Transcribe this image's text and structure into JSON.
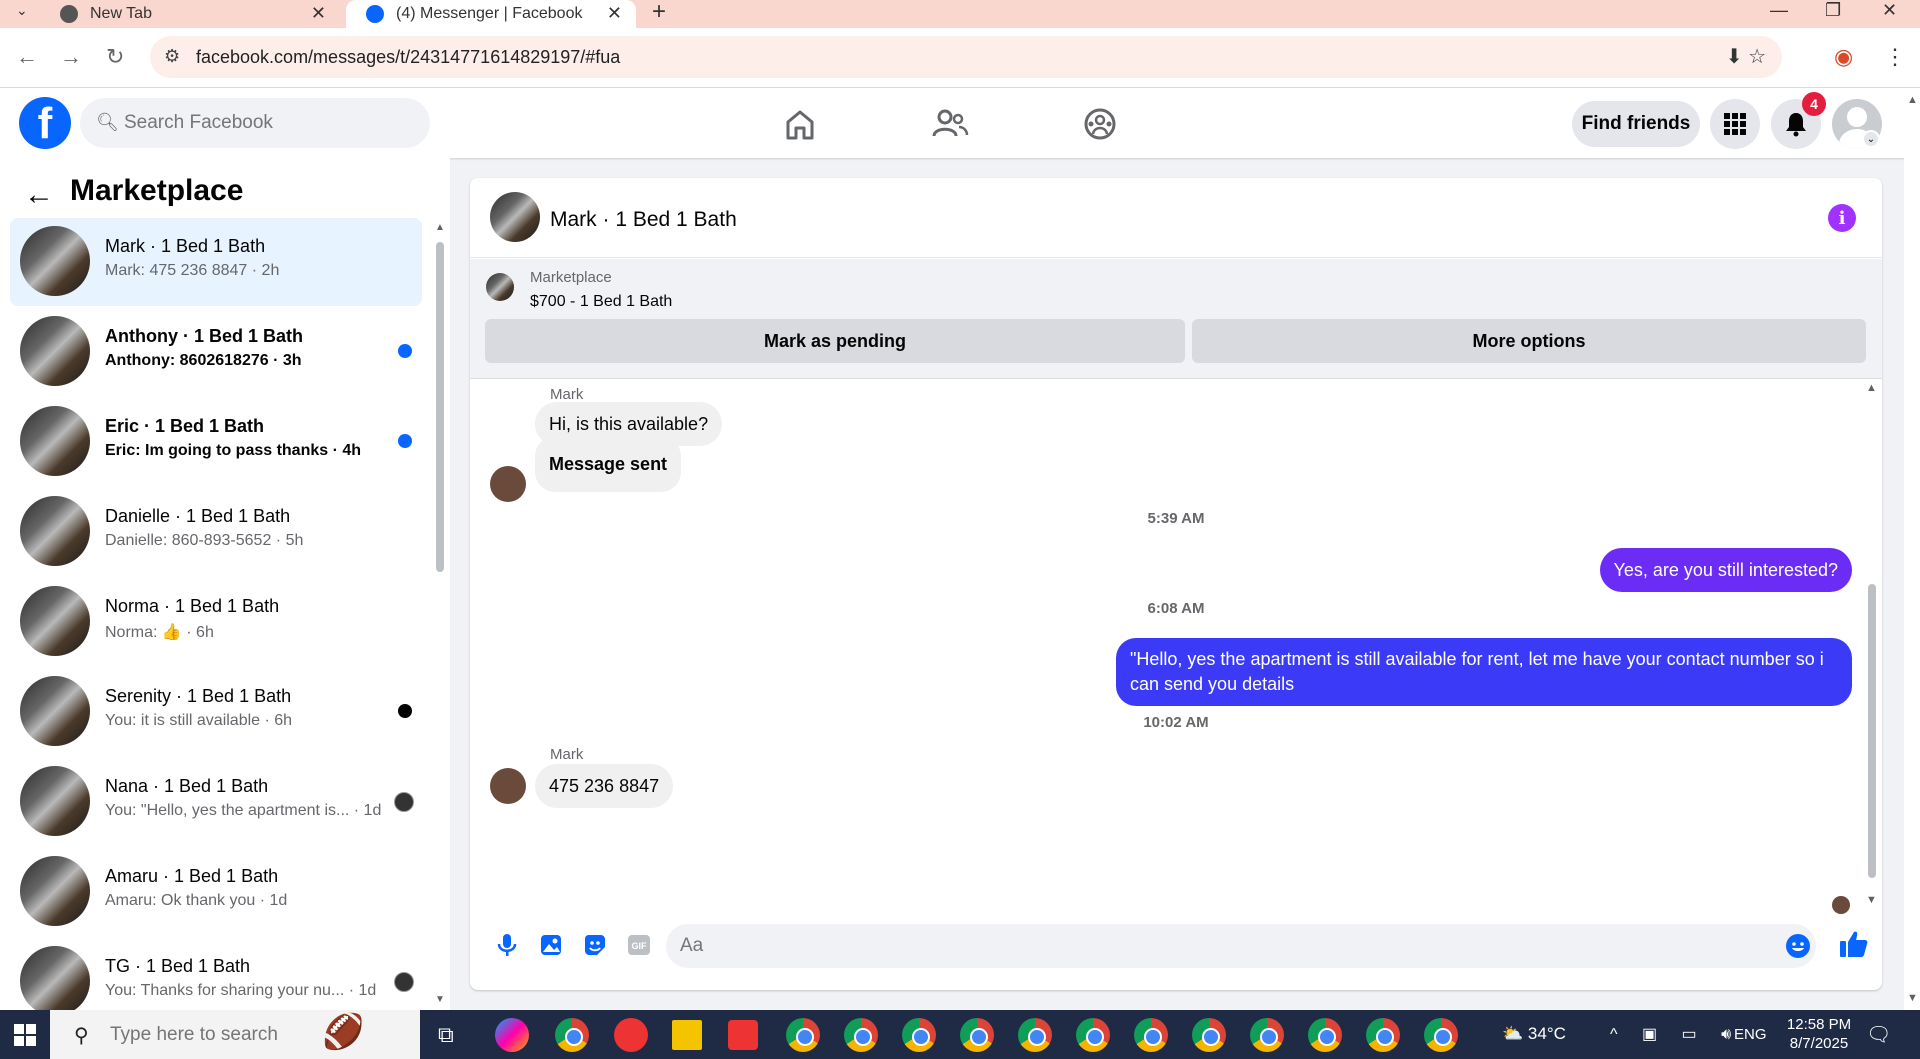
{
  "browser": {
    "tabs": [
      {
        "title": "New Tab",
        "active": false
      },
      {
        "title": "(4) Messenger | Facebook",
        "active": true
      }
    ],
    "url": "facebook.com/messages/t/24314771614829197/#fua"
  },
  "header": {
    "search_placeholder": "Search Facebook",
    "find_friends": "Find friends",
    "notification_count": "4"
  },
  "sidebar": {
    "title": "Marketplace",
    "conversations": [
      {
        "name": "Mark · 1 Bed 1 Bath",
        "preview": "Mark: 475 236 8847 · 2h",
        "selected": true,
        "unread": false
      },
      {
        "name": "Anthony · 1 Bed 1 Bath",
        "preview": "Anthony: 8602618276 · 3h",
        "selected": false,
        "unread": true
      },
      {
        "name": "Eric · 1 Bed 1 Bath",
        "preview": "Eric: Im going to pass thanks · 4h",
        "selected": false,
        "unread": true
      },
      {
        "name": "Danielle · 1 Bed 1 Bath",
        "preview": "Danielle: 860-893-5652 · 5h",
        "selected": false,
        "unread": false
      },
      {
        "name": "Norma · 1 Bed 1 Bath",
        "preview": "Norma: 👍 · 6h",
        "selected": false,
        "unread": false
      },
      {
        "name": "Serenity · 1 Bed 1 Bath",
        "preview": "You: it is still available · 6h",
        "selected": false,
        "unread": false
      },
      {
        "name": "Nana · 1 Bed 1 Bath",
        "preview": "You: \"Hello, yes the apartment is... · 1d",
        "selected": false,
        "unread": false
      },
      {
        "name": "Amaru · 1 Bed 1 Bath",
        "preview": "Amaru: Ok thank you · 1d",
        "selected": false,
        "unread": false
      },
      {
        "name": "TG · 1 Bed 1 Bath",
        "preview": "You: Thanks for sharing your nu... · 1d",
        "selected": false,
        "unread": false
      }
    ]
  },
  "chat": {
    "contact": "Mark · 1 Bed 1 Bath",
    "marketplace_label": "Marketplace",
    "listing": "$700 - 1 Bed 1 Bath",
    "mark_pending": "Mark as pending",
    "more_options": "More options",
    "sender_name": "Mark",
    "msg1": "Hi, is this available?",
    "msg2": "Message sent",
    "time1": "5:39 AM",
    "msg3": "Yes, are you still interested?",
    "time2": "6:08 AM",
    "msg4": "\"Hello, yes the apartment is still available for rent, let me have your contact number so i can send you details",
    "time3": "10:02 AM",
    "msg5": "475 236 8847",
    "input_placeholder": "Aa"
  },
  "taskbar": {
    "search_placeholder": "Type here to search",
    "weather": "34°C",
    "lang": "ENG",
    "time": "12:58 PM",
    "date": "8/7/2025"
  },
  "colors": {
    "fb_blue": "#0866ff",
    "outgoing_bubble": "#6b2cf5",
    "outgoing_bubble_2": "#3b3bf7",
    "selected_conv": "#e7f3ff",
    "unread_dot": "#0866ff"
  }
}
